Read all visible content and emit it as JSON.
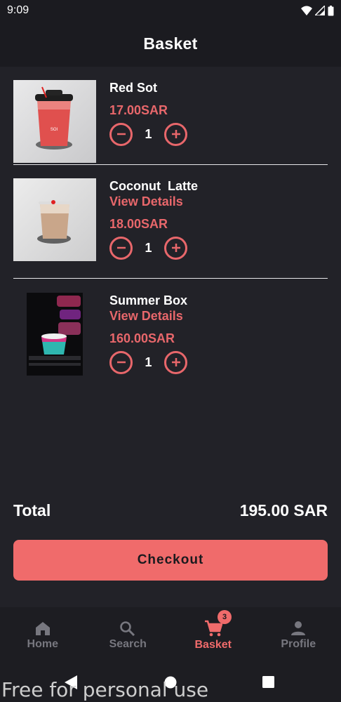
{
  "status_bar": {
    "time": "9:09"
  },
  "header": {
    "title": "Basket"
  },
  "items": [
    {
      "name": "Red Sot",
      "details_label": "",
      "price": "17.00SAR",
      "quantity": "1"
    },
    {
      "name": "Coconut  Latte",
      "details_label": "View Details",
      "price": "18.00SAR",
      "quantity": "1"
    },
    {
      "name": "Summer Box",
      "details_label": "View Details",
      "price": "160.00SAR",
      "quantity": "1"
    }
  ],
  "total": {
    "label": "Total",
    "value": "195.00 SAR"
  },
  "checkout": {
    "label": "Checkout"
  },
  "nav": [
    {
      "label": "Home",
      "icon": "home-icon"
    },
    {
      "label": "Search",
      "icon": "search-icon"
    },
    {
      "label": "Basket",
      "icon": "cart-icon",
      "badge": "3"
    },
    {
      "label": "Profile",
      "icon": "person-icon"
    }
  ],
  "watermark": "Free for personal use",
  "colors": {
    "accent": "#f06b6b",
    "background": "#222228",
    "bar": "#1b1b20"
  }
}
